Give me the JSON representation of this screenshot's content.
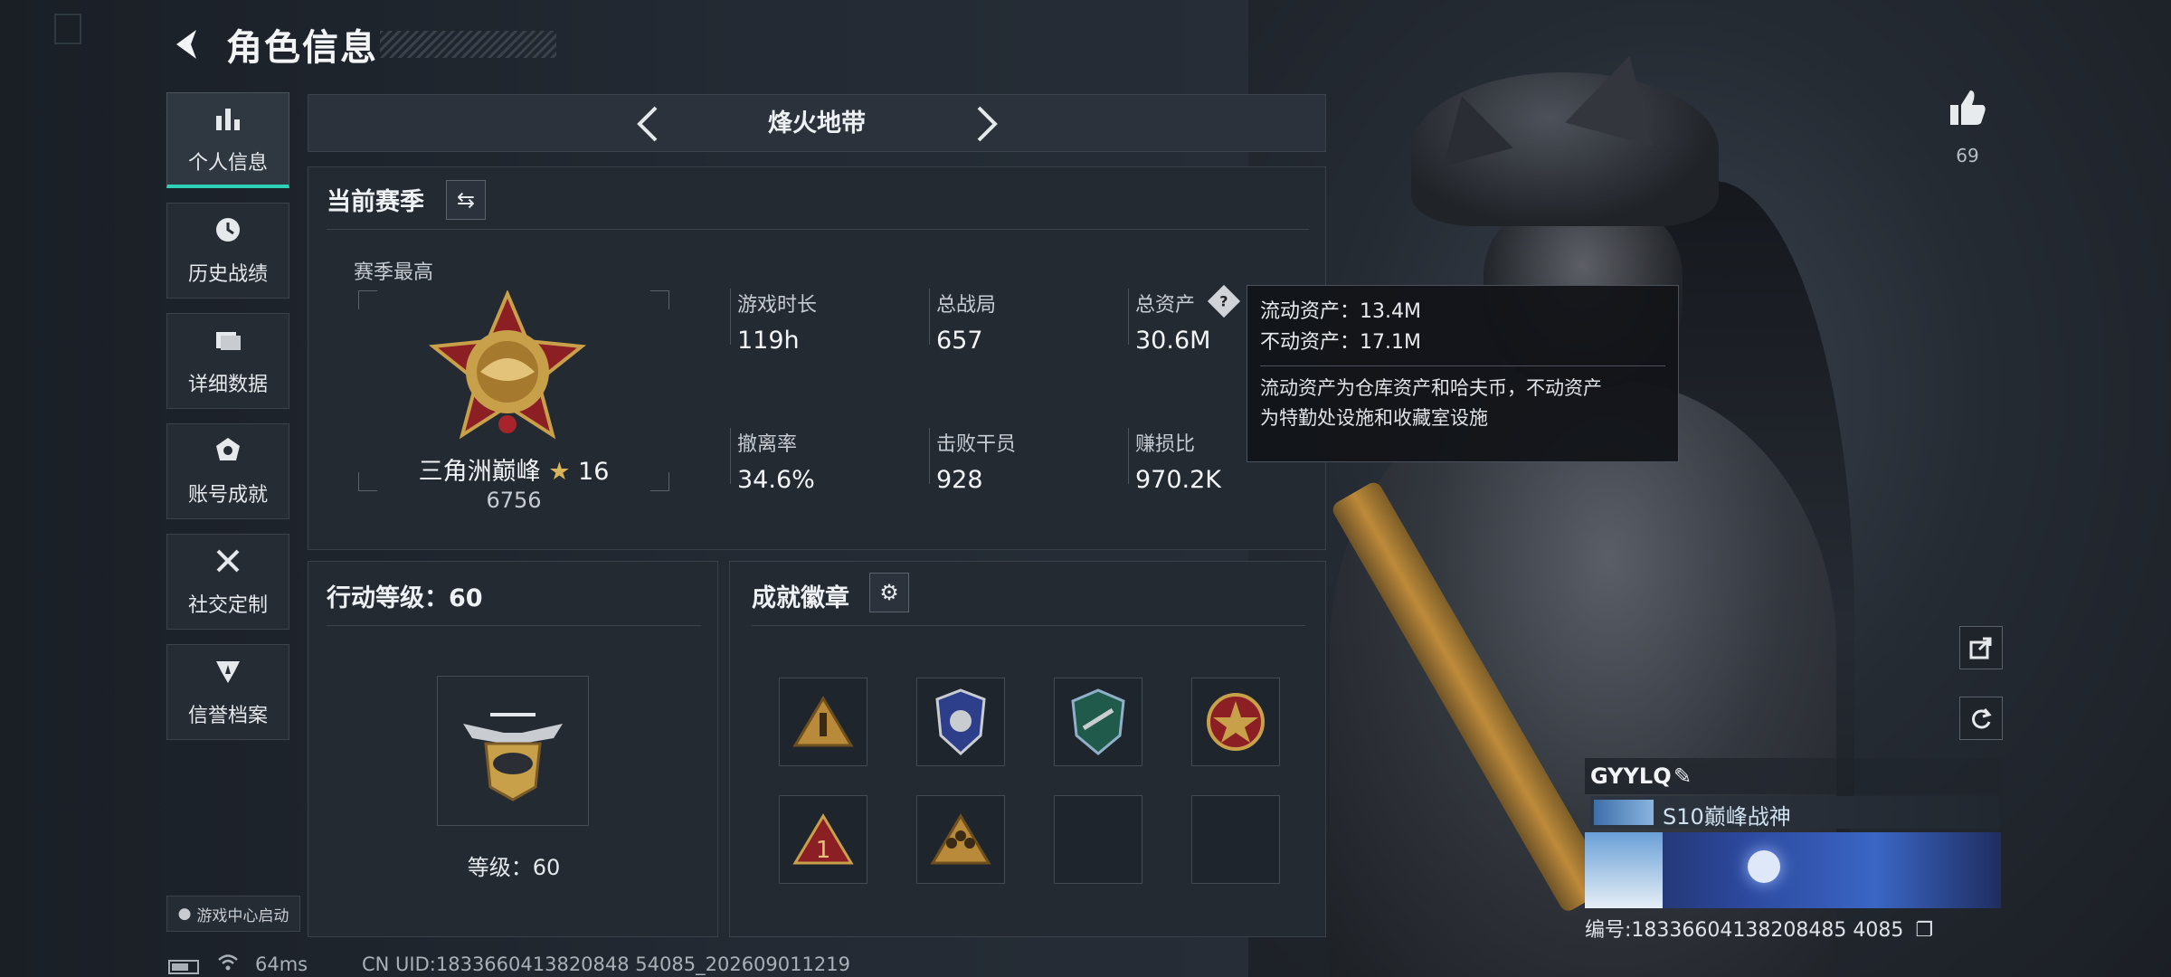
{
  "header": {
    "title": "角色信息"
  },
  "nav": [
    {
      "label": "个人信息",
      "icon": "bar-chart-icon",
      "active": true
    },
    {
      "label": "历史战绩",
      "icon": "clock-icon",
      "active": false
    },
    {
      "label": "详细数据",
      "icon": "folder-icon",
      "active": false
    },
    {
      "label": "账号成就",
      "icon": "achievement-icon",
      "active": false
    },
    {
      "label": "社交定制",
      "icon": "tools-icon",
      "active": false
    },
    {
      "label": "信誉档案",
      "icon": "reputation-icon",
      "active": false
    }
  ],
  "game_center": "游戏中心启动",
  "mode_tab": {
    "title": "烽火地带"
  },
  "season": {
    "title": "当前赛季",
    "best_label": "赛季最高",
    "rank_name": "三角洲巅峰",
    "rank_stars": "16",
    "rank_score": "6756",
    "stats": [
      {
        "label": "游戏时长",
        "value": "119h"
      },
      {
        "label": "总战局",
        "value": "657"
      },
      {
        "label": "总资产",
        "value": "30.6M"
      },
      {
        "label": "撤离率",
        "value": "34.6%"
      },
      {
        "label": "击败干员",
        "value": "928"
      },
      {
        "label": "赚损比",
        "value": "970.2K"
      }
    ]
  },
  "tooltip": {
    "liquid": "流动资产：13.4M",
    "fixed": "不动资产：17.1M",
    "desc1": "流动资产为仓库资产和哈夫币，不动资产",
    "desc2": "为特勤处设施和收藏室设施"
  },
  "action_level": {
    "title": "行动等级：60",
    "level_text": "等级：60"
  },
  "badges": {
    "title": "成就徽章",
    "slots": [
      "badge-triangle-icon",
      "badge-police-icon",
      "badge-shield-icon",
      "badge-star-icon",
      "badge-one-icon",
      "badge-team-icon",
      "",
      ""
    ]
  },
  "like": {
    "count": "69"
  },
  "player": {
    "name": "GYYLQ",
    "title": "S10巅峰战神",
    "uid_line": "编号:18336604138208485 4085"
  },
  "status": {
    "ping": "64ms",
    "uid": "CN UID:1833660413820848 54085_202609011219"
  },
  "colors": {
    "accent": "#2fd0b8",
    "panel": "#242a32",
    "gold": "#c9a04a"
  }
}
